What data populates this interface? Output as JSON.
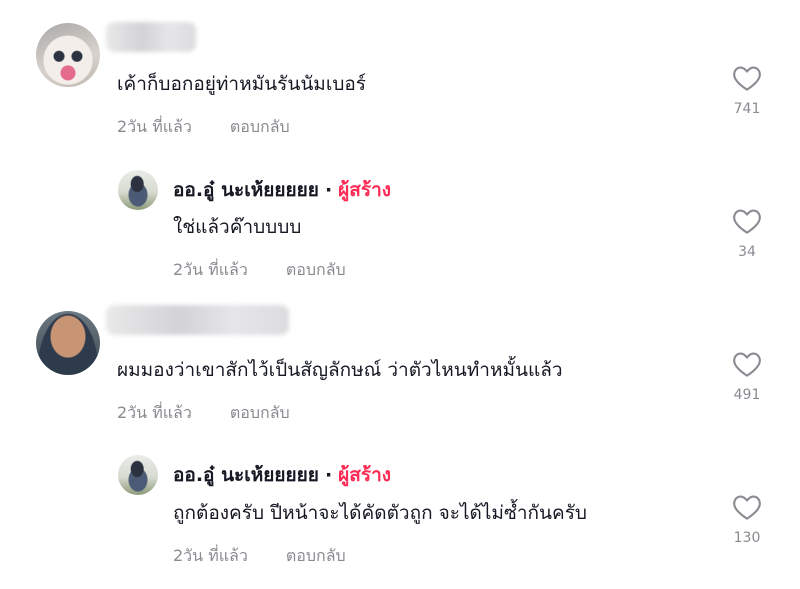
{
  "comments": [
    {
      "text": "เค้าก็บอกอยู่ท่าหมันรันนัมเบอร์",
      "time": "2วัน ที่แล้ว",
      "reply_label": "ตอบกลับ",
      "likes": "741",
      "replies": [
        {
          "author": "ออ.อู๋ นะเห้ยยยยย",
          "separator": "·",
          "badge": "ผู้สร้าง",
          "text": "ใช่แล้วค๊าบบบบ",
          "time": "2วัน ที่แล้ว",
          "reply_label": "ตอบกลับ",
          "likes": "34"
        }
      ]
    },
    {
      "text": "ผมมองว่าเขาสักไว้เป็นสัญลักษณ์ ว่าตัวไหนทำหมั้นแล้ว",
      "time": "2วัน ที่แล้ว",
      "reply_label": "ตอบกลับ",
      "likes": "491",
      "replies": [
        {
          "author": "ออ.อู๋ นะเห้ยยยยย",
          "separator": "·",
          "badge": "ผู้สร้าง",
          "text": "ถูกต้องครับ ปีหน้าจะได้คัดตัวถูก จะได้ไม่ซ้ำกันครับ",
          "time": "2วัน ที่แล้ว",
          "reply_label": "ตอบกลับ",
          "likes": "130"
        }
      ]
    }
  ],
  "icons": {
    "like": "heart-outline-icon"
  },
  "colors": {
    "creator_badge": "#fe2c55",
    "meta_text": "#8a8b91",
    "primary_text": "#161823"
  }
}
